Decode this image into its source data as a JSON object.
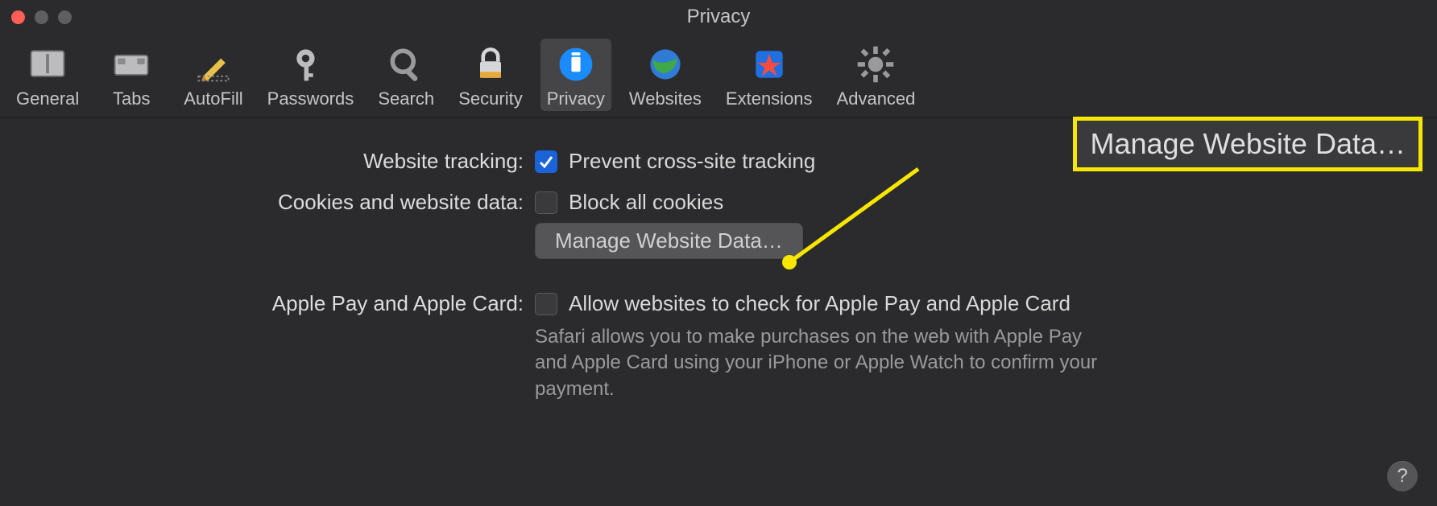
{
  "window": {
    "title": "Privacy"
  },
  "toolbar": [
    {
      "id": "general",
      "label": "General"
    },
    {
      "id": "tabs",
      "label": "Tabs"
    },
    {
      "id": "autofill",
      "label": "AutoFill"
    },
    {
      "id": "passwords",
      "label": "Passwords"
    },
    {
      "id": "search",
      "label": "Search"
    },
    {
      "id": "security",
      "label": "Security"
    },
    {
      "id": "privacy",
      "label": "Privacy",
      "active": true
    },
    {
      "id": "websites",
      "label": "Websites"
    },
    {
      "id": "extensions",
      "label": "Extensions"
    },
    {
      "id": "advanced",
      "label": "Advanced"
    }
  ],
  "sections": {
    "tracking": {
      "label": "Website tracking:",
      "checkbox_label": "Prevent cross-site tracking",
      "checked": true
    },
    "cookies": {
      "label": "Cookies and website data:",
      "checkbox_label": "Block all cookies",
      "checked": false,
      "button_label": "Manage Website Data…"
    },
    "applepay": {
      "label": "Apple Pay and Apple Card:",
      "checkbox_label": "Allow websites to check for Apple Pay and Apple Card",
      "checked": false,
      "description": "Safari allows you to make purchases on the web with Apple Pay and Apple Card using your iPhone or Apple Watch to confirm your payment."
    }
  },
  "callout": {
    "text": "Manage Website Data…"
  },
  "help": {
    "glyph": "?"
  }
}
